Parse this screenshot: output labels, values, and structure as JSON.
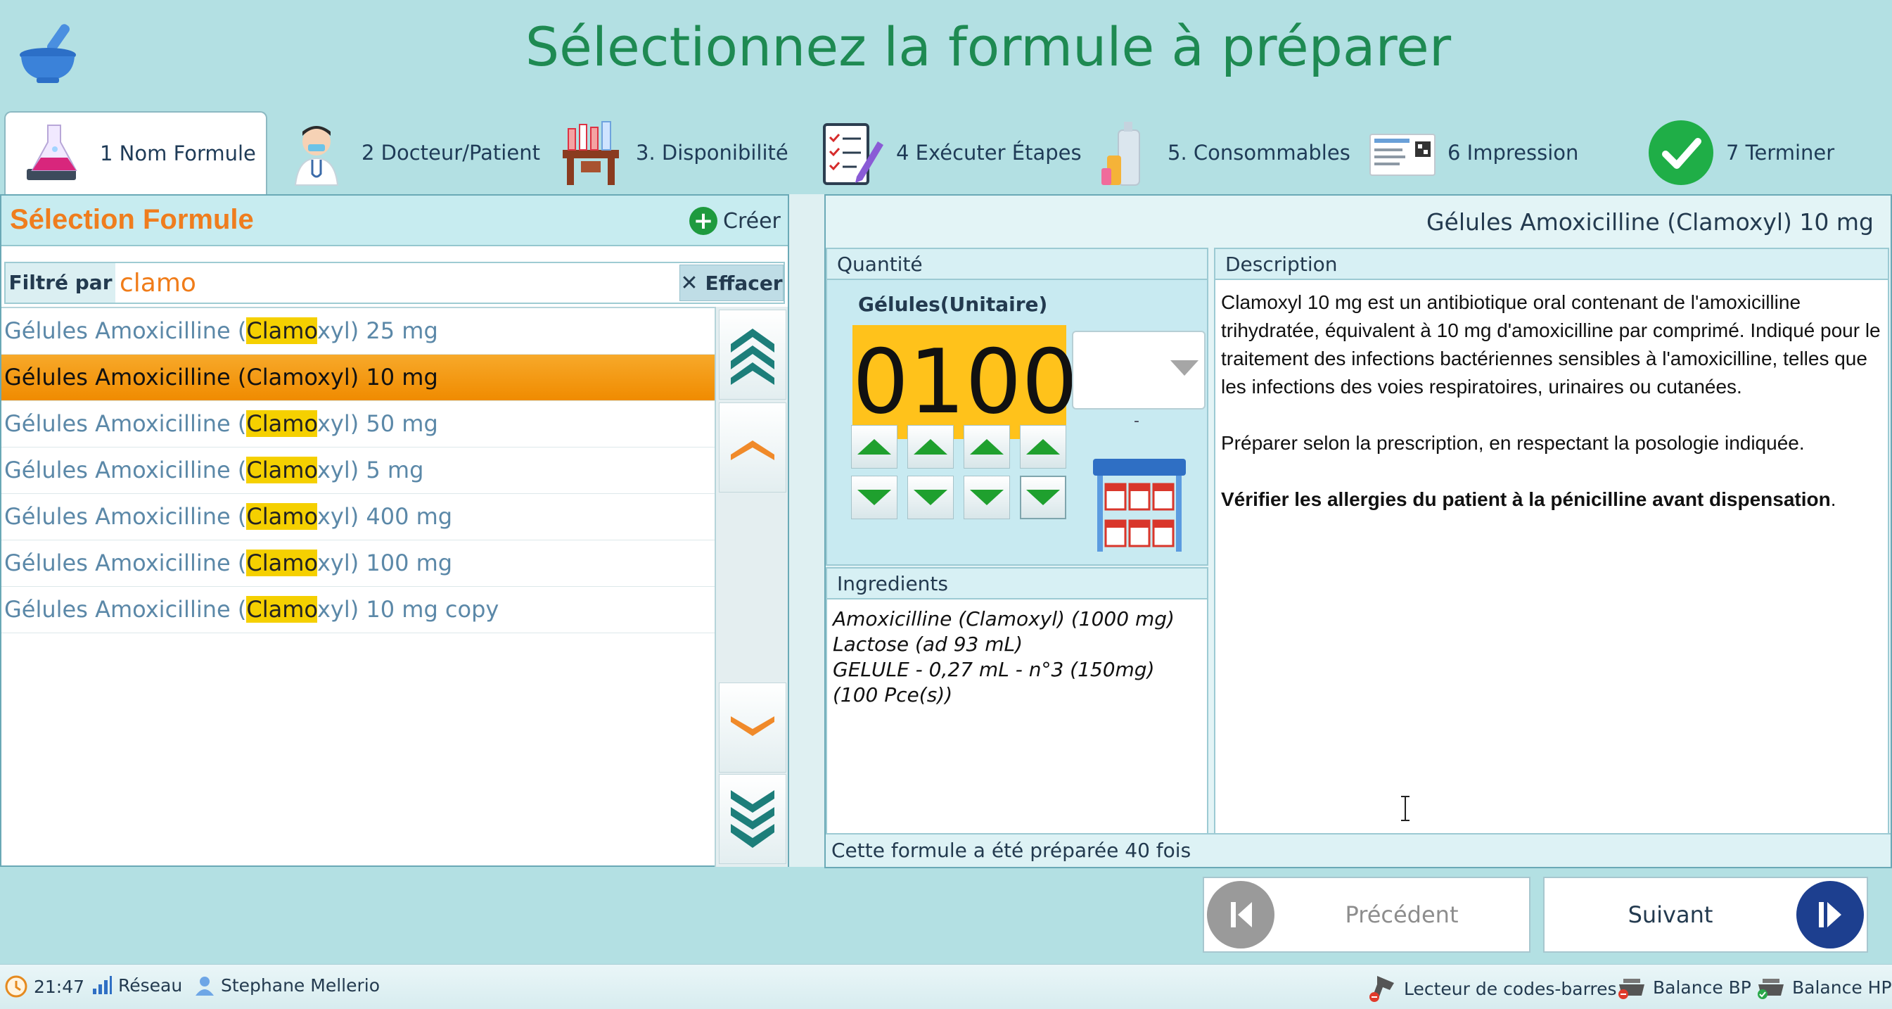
{
  "header": {
    "title": "Sélectionnez la formule à préparer"
  },
  "steps": [
    {
      "label": "1  Nom Formule",
      "icon": "flask-book-icon",
      "active": true
    },
    {
      "label": "2  Docteur/Patient",
      "icon": "doctor-icon"
    },
    {
      "label": "3.  Disponibilité",
      "icon": "shelf-icon"
    },
    {
      "label": "4  Exécuter Étapes",
      "icon": "checklist-icon"
    },
    {
      "label": "5.  Consommables",
      "icon": "bottles-icon"
    },
    {
      "label": "6  Impression",
      "icon": "label-print-icon"
    },
    {
      "label": "7  Terminer",
      "icon": "check-circle-icon"
    }
  ],
  "left": {
    "title": "Sélection Formule",
    "create_label": "Créer",
    "filter_label": "Filtré par",
    "filter_value": "clamo",
    "clear_label": "Effacer",
    "formulas": [
      {
        "pre": "Gélules Amoxicilline (",
        "match": "Clamo",
        "post": "xyl) 25 mg"
      },
      {
        "pre": "Gélules Amoxicilline (",
        "match": "Clamo",
        "post": "xyl) 10 mg",
        "selected": true
      },
      {
        "pre": "Gélules Amoxicilline (",
        "match": "Clamo",
        "post": "xyl) 50 mg"
      },
      {
        "pre": "Gélules Amoxicilline (",
        "match": "Clamo",
        "post": "xyl) 5 mg"
      },
      {
        "pre": "Gélules Amoxicilline (",
        "match": "Clamo",
        "post": "xyl) 400 mg"
      },
      {
        "pre": "Gélules Amoxicilline (",
        "match": "Clamo",
        "post": "xyl) 100 mg"
      },
      {
        "pre": "Gélules Amoxicilline (",
        "match": "Clamo",
        "post": "xyl) 10 mg copy"
      }
    ]
  },
  "right": {
    "title": "Gélules Amoxicilline (Clamoxyl) 10 mg",
    "quantity": {
      "header": "Quantité",
      "unit": "Gélules(Unitaire)",
      "value": "0100",
      "dash": "-"
    },
    "ingredients": {
      "header": "Ingredients",
      "items": [
        "Amoxicilline (Clamoxyl) (1000 mg)",
        "Lactose (ad 93 mL)",
        "GELULE - 0,27 mL - n°3 (150mg) (100 Pce(s))"
      ]
    },
    "description": {
      "header": "Description",
      "p1": "Clamoxyl 10 mg est un antibiotique oral contenant de l'amoxicilline trihydratée, équivalent à 10 mg d'amoxicilline par comprimé. Indiqué pour le traitement des infections bactériennes sensibles à l'amoxicilline, telles que les infections des voies respiratoires, urinaires ou cutanées.",
      "p2": "Préparer selon la prescription, en respectant la posologie indiquée.",
      "p3_bold": "Vérifier les allergies du patient à la pénicilline avant dispensation",
      "p3_tail": "."
    },
    "prep_count": "Cette formule a été préparée 40 fois"
  },
  "nav": {
    "prev_label": "Précédent",
    "next_label": "Suivant"
  },
  "status": {
    "time": "21:47",
    "network": "Réseau",
    "user": "Stephane Mellerio",
    "barcode": "Lecteur de codes-barres",
    "balance_bp": "Balance BP",
    "balance_hp": "Balance HP"
  },
  "colors": {
    "accent_orange": "#ef7d1e",
    "title_green": "#1e8a52",
    "quantity_bg": "#ffc21b",
    "selected_row": "#f08b00",
    "highlight": "#f5d000"
  }
}
